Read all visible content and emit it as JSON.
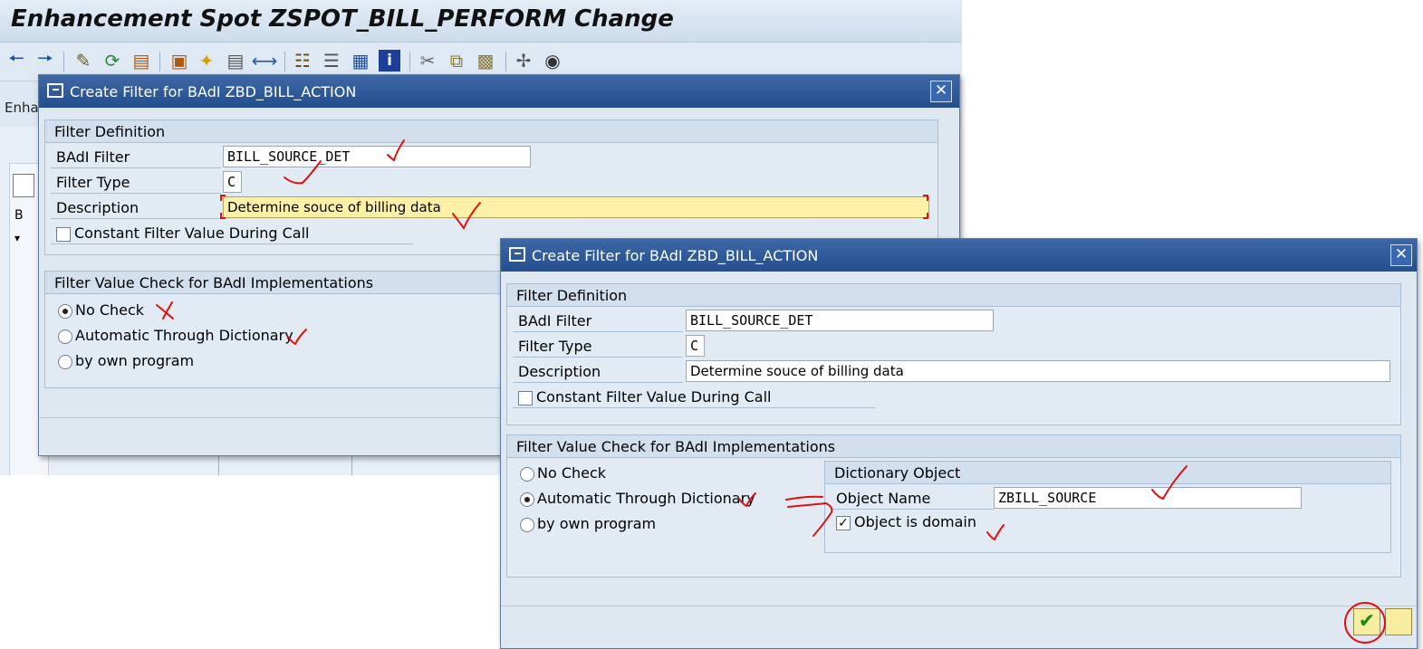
{
  "background": {
    "title": "Enhancement Spot ZSPOT_BILL_PERFORM Change",
    "enh_label": "Enha",
    "tree_label": "B",
    "toolbar_icons": [
      "back-icon",
      "forward-icon",
      "edit-icon",
      "display-change-icon",
      "activate-icon",
      "where-used-icon",
      "lightbulb-icon",
      "window-icon",
      "navigate-icon",
      "hierarchy-icon",
      "stack-icon",
      "list-icon",
      "info-icon",
      "cut-icon",
      "copy-icon",
      "paste-icon",
      "pattern-icon",
      "binoculars-icon"
    ]
  },
  "dialog1": {
    "title": "Create Filter for BAdI ZBD_BILL_ACTION",
    "filter_definition_header": "Filter Definition",
    "badi_filter_label": "BAdI Filter",
    "badi_filter_value": "BILL_SOURCE_DET",
    "filter_type_label": "Filter Type",
    "filter_type_value": "C",
    "description_label": "Description",
    "description_value": "Determine souce of billing data",
    "constant_label": "Constant Filter Value During Call",
    "constant_checked": false,
    "value_check_header": "Filter Value Check for BAdI Implementations",
    "radio_no_check": "No Check",
    "radio_auto": "Automatic Through Dictionary",
    "radio_program": "by own program",
    "selected": "No Check"
  },
  "dialog2": {
    "title": "Create Filter for BAdI ZBD_BILL_ACTION",
    "filter_definition_header": "Filter Definition",
    "badi_filter_label": "BAdI Filter",
    "badi_filter_value": "BILL_SOURCE_DET",
    "filter_type_label": "Filter Type",
    "filter_type_value": "C",
    "description_label": "Description",
    "description_value": "Determine souce of billing data",
    "constant_label": "Constant Filter Value During Call",
    "constant_checked": false,
    "value_check_header": "Filter Value Check for BAdI Implementations",
    "radio_no_check": "No Check",
    "radio_auto": "Automatic Through Dictionary",
    "radio_program": "by own program",
    "selected": "Automatic Through Dictionary",
    "dict_header": "Dictionary Object",
    "object_name_label": "Object Name",
    "object_name_value": "ZBILL_SOURCE",
    "object_domain_label": "Object is domain",
    "object_domain_checked": true
  },
  "colors": {
    "title_bar": "#2d5897",
    "annotation": "#e01010",
    "highlight_field": "#fdf1a8"
  }
}
